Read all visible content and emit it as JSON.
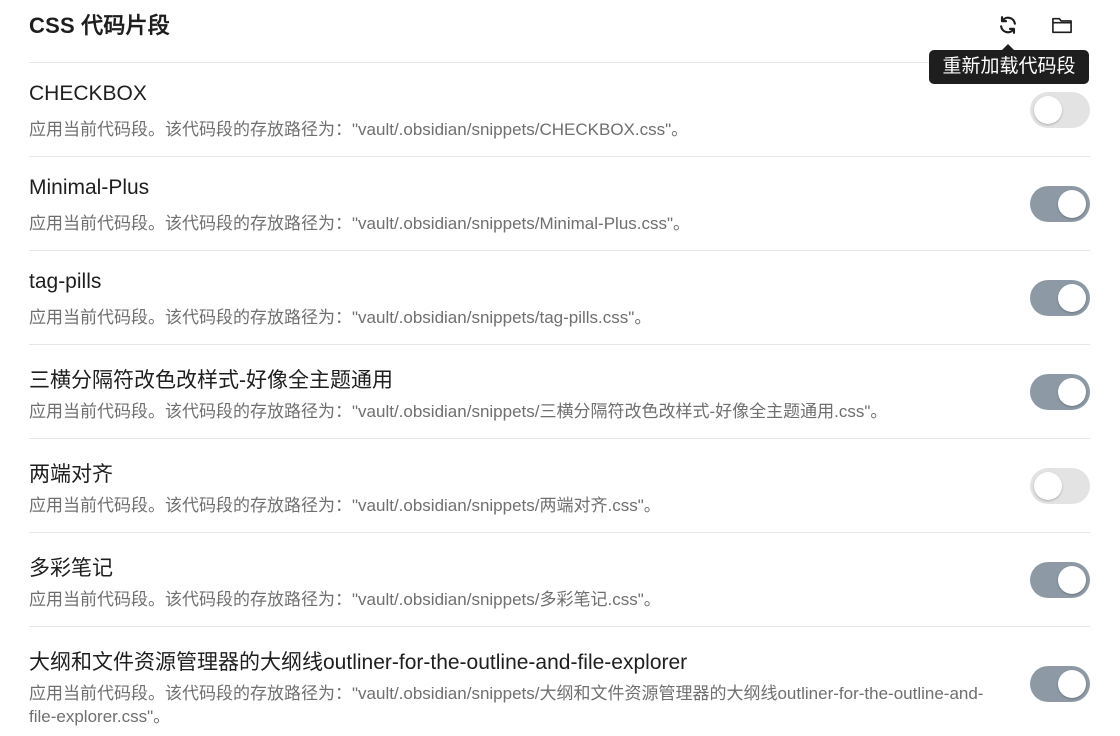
{
  "header": {
    "title": "CSS 代码片段",
    "reload_icon": "reload-icon",
    "folder_icon": "folder-icon"
  },
  "tooltip": {
    "text": "重新加载代码段"
  },
  "colors": {
    "toggle_on": "#8d9aa6",
    "toggle_off": "#e3e3e3"
  },
  "snippets": [
    {
      "name": "CHECKBOX",
      "description": "应用当前代码段。该代码段的存放路径为：\"vault/.obsidian/snippets/CHECKBOX.css\"。",
      "enabled": false
    },
    {
      "name": "Minimal-Plus",
      "description": "应用当前代码段。该代码段的存放路径为：\"vault/.obsidian/snippets/Minimal-Plus.css\"。",
      "enabled": true
    },
    {
      "name": "tag-pills",
      "description": "应用当前代码段。该代码段的存放路径为：\"vault/.obsidian/snippets/tag-pills.css\"。",
      "enabled": true
    },
    {
      "name": "三横分隔符改色改样式-好像全主题通用",
      "description": "应用当前代码段。该代码段的存放路径为：\"vault/.obsidian/snippets/三横分隔符改色改样式-好像全主题通用.css\"。",
      "enabled": true
    },
    {
      "name": "两端对齐",
      "description": "应用当前代码段。该代码段的存放路径为：\"vault/.obsidian/snippets/两端对齐.css\"。",
      "enabled": false
    },
    {
      "name": "多彩笔记",
      "description": "应用当前代码段。该代码段的存放路径为：\"vault/.obsidian/snippets/多彩笔记.css\"。",
      "enabled": true
    },
    {
      "name": "大纲和文件资源管理器的大纲线outliner-for-the-outline-and-file-explorer",
      "description": "应用当前代码段。该代码段的存放路径为：\"vault/.obsidian/snippets/大纲和文件资源管理器的大纲线outliner-for-the-outline-and-file-explorer.css\"。",
      "enabled": true
    }
  ]
}
